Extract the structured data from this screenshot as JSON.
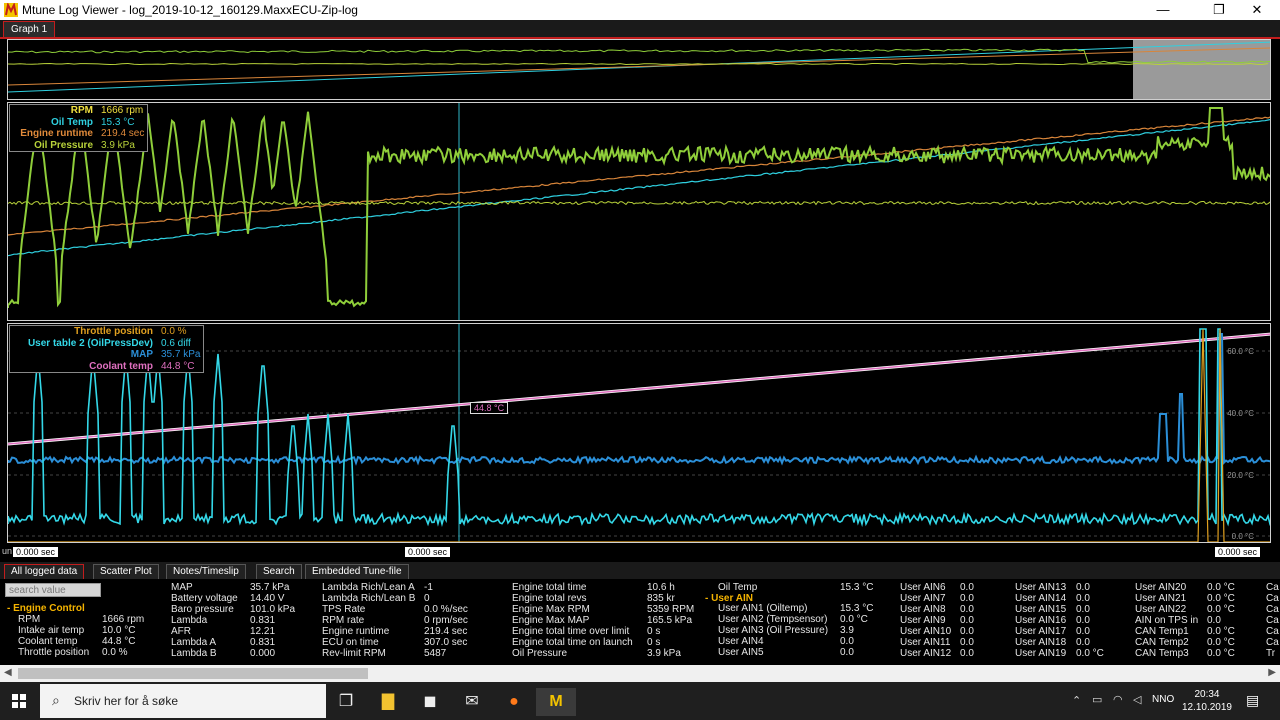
{
  "window": {
    "title": "Mtune Log Viewer - log_2019-10-12_160129.MaxxECU-Zip-log",
    "minimize": "—",
    "maximize": "❐",
    "close": "✕"
  },
  "graph_tabs": [
    "Graph 1"
  ],
  "colors": {
    "rpm": "#8fce3a",
    "oil_temp": "#2fd0e0",
    "engine_runtime": "#d8853a",
    "oil_pressure": "#b8d23a",
    "throttle": "#e0a020",
    "user_table2": "#34d8e8",
    "map": "#2b8fd8",
    "coolant": "#e070c0",
    "accent_red": "#c21d1d"
  },
  "panel1": {
    "legend": [
      {
        "name": "RPM",
        "value": "1666 rpm",
        "color": "#f0e040"
      },
      {
        "name": "Oil Temp",
        "value": "15.3 °C",
        "color": "#2fd0e0"
      },
      {
        "name": "Engine runtime",
        "value": "219.4 sec",
        "color": "#e08a3a"
      },
      {
        "name": "Oil Pressure",
        "value": "3.9 kPa",
        "color": "#b8d23a"
      }
    ]
  },
  "panel2": {
    "legend": [
      {
        "name": "Throttle position",
        "value": "0.0 %",
        "color": "#e0a020"
      },
      {
        "name": "User table 2 (OilPressDev)",
        "value": "0.6 diff",
        "color": "#34d8e8"
      },
      {
        "name": "MAP",
        "value": "35.7 kPa",
        "color": "#2b8fd8"
      },
      {
        "name": "Coolant temp",
        "value": "44.8 °C",
        "color": "#e070c0"
      }
    ],
    "cursor_label": "44.8 °C",
    "y_ticks": [
      "60.0 °C",
      "40.0 °C",
      "20.0 °C",
      "0.0 °C"
    ]
  },
  "time_labels": {
    "left": "0.000 sec",
    "left_prefix": "un",
    "cursor": "0.000 sec",
    "right": "0.000 sec"
  },
  "bottom_tabs": [
    "All logged data",
    "Scatter Plot",
    "Notes/Timeslip",
    "Search",
    "Embedded Tune-file"
  ],
  "search": {
    "placeholder": "search value"
  },
  "group_headers": {
    "engine_control": "- Engine Control",
    "user_ain": "- User AIN"
  },
  "col1": [
    {
      "k": "RPM",
      "v": "1666 rpm"
    },
    {
      "k": "Intake air temp",
      "v": "10.0 °C"
    },
    {
      "k": "Coolant temp",
      "v": "44.8 °C"
    },
    {
      "k": "Throttle position",
      "v": "0.0 %"
    }
  ],
  "col2": [
    {
      "k": "MAP",
      "v": "35.7 kPa"
    },
    {
      "k": "Battery voltage",
      "v": "14.40 V"
    },
    {
      "k": "Baro pressure",
      "v": "101.0 kPa"
    },
    {
      "k": "Lambda",
      "v": "0.831"
    },
    {
      "k": "AFR",
      "v": "12.21"
    },
    {
      "k": "Lambda A",
      "v": "0.831"
    },
    {
      "k": "Lambda B",
      "v": "0.000"
    }
  ],
  "col3": [
    {
      "k": "Lambda Rich/Lean A",
      "v": "-1"
    },
    {
      "k": "Lambda Rich/Lean B",
      "v": "0"
    },
    {
      "k": "TPS Rate",
      "v": "0.0 %/sec"
    },
    {
      "k": "RPM rate",
      "v": "0 rpm/sec"
    },
    {
      "k": "Engine runtime",
      "v": "219.4 sec"
    },
    {
      "k": "ECU on time",
      "v": "307.0 sec"
    },
    {
      "k": "Rev-limit RPM",
      "v": "5487"
    }
  ],
  "col4": [
    {
      "k": "Engine total time",
      "v": "10.6 h"
    },
    {
      "k": "Engine total revs",
      "v": "835 kr"
    },
    {
      "k": "Engine Max RPM",
      "v": "5359 RPM"
    },
    {
      "k": "Engine Max MAP",
      "v": "165.5 kPa"
    },
    {
      "k": "Engine total time over limit",
      "v": "0 s"
    },
    {
      "k": "Engine total time on launch",
      "v": "0 s"
    },
    {
      "k": "Oil Pressure",
      "v": "3.9 kPa"
    }
  ],
  "col5": [
    {
      "k": "Oil Temp",
      "v": "15.3 °C"
    },
    {
      "k": "User AIN1 (Oiltemp)",
      "v": "15.3 °C"
    },
    {
      "k": "User AIN2 (Tempsensor)",
      "v": "0.0 °C"
    },
    {
      "k": "User AIN3 (Oil Pressure)",
      "v": "3.9"
    },
    {
      "k": "User AIN4",
      "v": "0.0"
    },
    {
      "k": "User AIN5",
      "v": "0.0"
    }
  ],
  "col6": [
    {
      "k": "User AIN6",
      "v": "0.0"
    },
    {
      "k": "User AIN7",
      "v": "0.0"
    },
    {
      "k": "User AIN8",
      "v": "0.0"
    },
    {
      "k": "User AIN9",
      "v": "0.0"
    },
    {
      "k": "User AIN10",
      "v": "0.0"
    },
    {
      "k": "User AIN11",
      "v": "0.0"
    },
    {
      "k": "User AIN12",
      "v": "0.0"
    }
  ],
  "col7": [
    {
      "k": "User AIN13",
      "v": "0.0"
    },
    {
      "k": "User AIN14",
      "v": "0.0"
    },
    {
      "k": "User AIN15",
      "v": "0.0"
    },
    {
      "k": "User AIN16",
      "v": "0.0"
    },
    {
      "k": "User AIN17",
      "v": "0.0"
    },
    {
      "k": "User AIN18",
      "v": "0.0"
    },
    {
      "k": "User AIN19",
      "v": "0.0 °C"
    }
  ],
  "col8": [
    {
      "k": "User AIN20",
      "v": "0.0 °C"
    },
    {
      "k": "User AIN21",
      "v": "0.0 °C"
    },
    {
      "k": "User AIN22",
      "v": "0.0 °C"
    },
    {
      "k": "AIN on TPS in",
      "v": "0.0"
    },
    {
      "k": "CAN Temp1",
      "v": "0.0 °C"
    },
    {
      "k": "CAN Temp2",
      "v": "0.0 °C"
    },
    {
      "k": "CAN Temp3",
      "v": "0.0 °C"
    }
  ],
  "col9_cut": [
    "Ca",
    "Ca",
    "Ca",
    "Ca",
    "Ca",
    "Ca",
    "Tr"
  ],
  "taskbar": {
    "search_placeholder": "Skriv her for å søke",
    "lang": "NNO",
    "time": "20:34",
    "date": "12.10.2019"
  }
}
